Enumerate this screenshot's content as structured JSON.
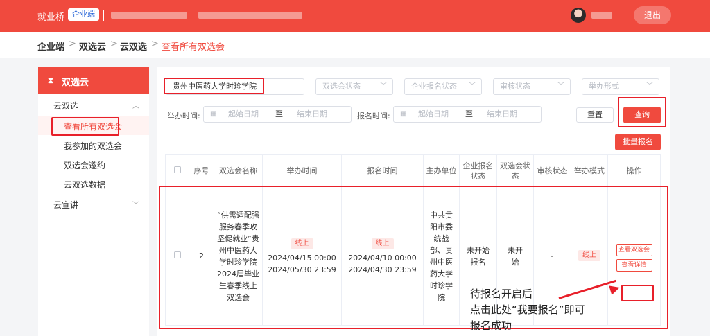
{
  "header": {
    "brand": "就业桥",
    "badge": "企业端",
    "logout": "退出"
  },
  "breadcrumb": {
    "items": [
      "企业端",
      "双选云",
      "云双选",
      "查看所有双选会"
    ],
    "separator": ">"
  },
  "sidebar": {
    "title": "双选云",
    "title_icon": "hourglass-icon",
    "groups": [
      {
        "label": "云双选",
        "expanded": true,
        "items": [
          "查看所有双选会",
          "我参加的双选会",
          "双选会邀约",
          "云双选数据"
        ]
      },
      {
        "label": "云宣讲",
        "expanded": false
      }
    ],
    "active_item": "查看所有双选会"
  },
  "filters": {
    "search_value": "贵州中医药大学时珍学院",
    "status_placeholder": "双选会状态",
    "enroll_status_placeholder": "企业报名状态",
    "audit_status_placeholder": "审核状态",
    "form_placeholder": "举办形式",
    "hold_time_label": "举办时间:",
    "enroll_time_label": "报名时间:",
    "start_placeholder": "起始日期",
    "to": "至",
    "end_placeholder": "结束日期",
    "reset": "重置",
    "query": "查询",
    "batch_enroll": "批量报名"
  },
  "table": {
    "headers": [
      "",
      "序号",
      "双选会名称",
      "举办时间",
      "报名时间",
      "主办单位",
      "企业报名状态",
      "双选会状态",
      "审核状态",
      "举办模式",
      "操作"
    ],
    "rows": [
      {
        "index": "2",
        "name": "“供需适配强服务春季攻坚促就业”贵州中医药大学时珍学院2024届毕业生春季线上双选会",
        "hold_tag": "线上",
        "hold_start": "2024/04/15 00:00",
        "hold_end": "2024/05/30 23:59",
        "enroll_tag": "线上",
        "enroll_start": "2024/04/10 00:00",
        "enroll_end": "2024/04/30 23:59",
        "organizer": "中共贵阳市委统战部、贵州中医药大学时珍学院",
        "enroll_status": "未开始报名",
        "fair_status": "未开始",
        "audit_status": "-",
        "mode": "线上",
        "actions": [
          "查看双选会",
          "查看详情"
        ]
      }
    ]
  },
  "annotation": {
    "line1": "待报名开启后",
    "line2": "点击此处“我要报名”即可",
    "line3": "报名成功"
  },
  "colors": {
    "brand_red": "#f04a3e",
    "highlight_red": "#e8202a",
    "link_blue": "#2d8cf0"
  }
}
